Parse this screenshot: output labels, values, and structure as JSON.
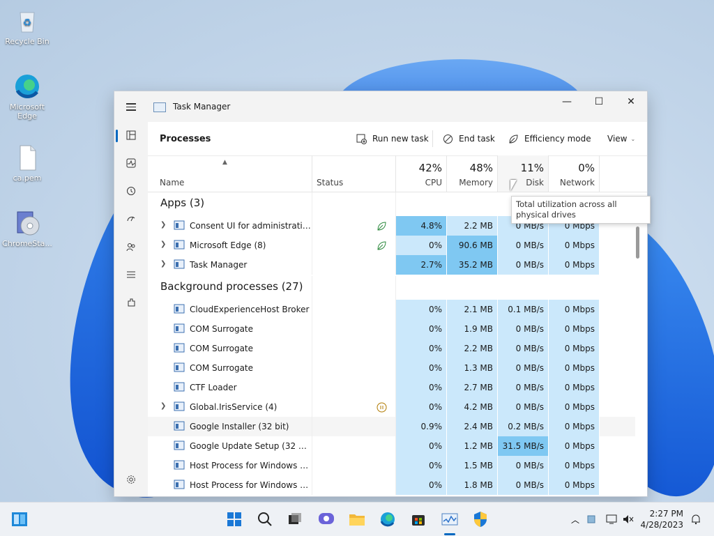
{
  "desktop": {
    "icons": [
      {
        "label": "Recycle Bin"
      },
      {
        "label": "Microsoft Edge"
      },
      {
        "label": "ca.pem"
      },
      {
        "label": "ChromeSta..."
      }
    ]
  },
  "window": {
    "title": "Task Manager",
    "minimize_glyph": "—",
    "maximize_glyph": "☐",
    "close_glyph": "✕"
  },
  "toolbar": {
    "page_title": "Processes",
    "run_new_task": "Run new task",
    "end_task": "End task",
    "efficiency_mode": "Efficiency mode",
    "view": "View"
  },
  "columns": {
    "name": "Name",
    "status": "Status",
    "cpu": {
      "pct": "42%",
      "label": "CPU"
    },
    "memory": {
      "pct": "48%",
      "label": "Memory"
    },
    "disk": {
      "pct": "11%",
      "label": "Disk"
    },
    "network": {
      "pct": "0%",
      "label": "Network"
    }
  },
  "tooltip": "Total utilization across all physical drives",
  "groups": {
    "apps": "Apps (3)",
    "background": "Background processes (27)"
  },
  "apps": [
    {
      "name": "Consent UI for administrative ...",
      "cpu": "4.8%",
      "memory": "2.2 MB",
      "disk": "0 MB/s",
      "network": "0 Mbps",
      "expandable": true,
      "status_icon": "efficiency-leaf-icon"
    },
    {
      "name": "Microsoft Edge (8)",
      "cpu": "0%",
      "memory": "90.6 MB",
      "disk": "0 MB/s",
      "network": "0 Mbps",
      "expandable": true,
      "status_icon": "efficiency-leaf-icon"
    },
    {
      "name": "Task Manager",
      "cpu": "2.7%",
      "memory": "35.2 MB",
      "disk": "0 MB/s",
      "network": "0 Mbps",
      "expandable": true
    }
  ],
  "background": [
    {
      "name": "CloudExperienceHost Broker",
      "cpu": "0%",
      "memory": "2.1 MB",
      "disk": "0.1 MB/s",
      "network": "0 Mbps"
    },
    {
      "name": "COM Surrogate",
      "cpu": "0%",
      "memory": "1.9 MB",
      "disk": "0 MB/s",
      "network": "0 Mbps"
    },
    {
      "name": "COM Surrogate",
      "cpu": "0%",
      "memory": "2.2 MB",
      "disk": "0 MB/s",
      "network": "0 Mbps"
    },
    {
      "name": "COM Surrogate",
      "cpu": "0%",
      "memory": "1.3 MB",
      "disk": "0 MB/s",
      "network": "0 Mbps"
    },
    {
      "name": "CTF Loader",
      "cpu": "0%",
      "memory": "2.7 MB",
      "disk": "0 MB/s",
      "network": "0 Mbps"
    },
    {
      "name": "Global.IrisService (4)",
      "cpu": "0%",
      "memory": "4.2 MB",
      "disk": "0 MB/s",
      "network": "0 Mbps",
      "expandable": true,
      "status_icon": "paused-icon"
    },
    {
      "name": "Google Installer (32 bit)",
      "cpu": "0.9%",
      "memory": "2.4 MB",
      "disk": "0.2 MB/s",
      "network": "0 Mbps"
    },
    {
      "name": "Google Update Setup (32 bit)",
      "cpu": "0%",
      "memory": "1.2 MB",
      "disk": "31.5 MB/s",
      "network": "0 Mbps"
    },
    {
      "name": "Host Process for Windows Tasks",
      "cpu": "0%",
      "memory": "1.5 MB",
      "disk": "0 MB/s",
      "network": "0 Mbps"
    },
    {
      "name": "Host Process for Windows Tasks",
      "cpu": "0%",
      "memory": "1.8 MB",
      "disk": "0 MB/s",
      "network": "0 Mbps"
    }
  ],
  "taskbar": {
    "time": "2:27 PM",
    "date": "4/28/2023"
  },
  "colors": {
    "accent": "#0067c0",
    "heat_low": "#cbe8fb",
    "heat_mid": "#9fd6f6",
    "heat_high": "#7fc8f2"
  }
}
